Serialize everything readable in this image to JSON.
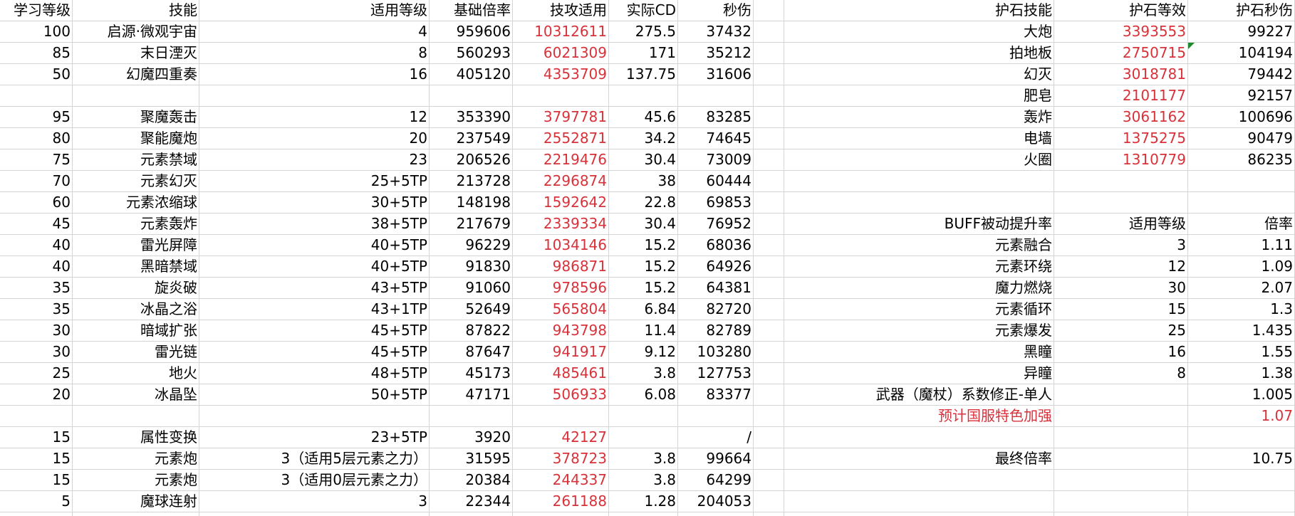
{
  "left": {
    "headers": [
      "学习等级",
      "技能",
      "适用等级",
      "基础倍率",
      "技攻适用",
      "实际CD",
      "秒伤"
    ],
    "rows": [
      [
        "100",
        "启源·微观宇宙",
        "4",
        "959606",
        "10312611",
        "275.5",
        "37432"
      ],
      [
        "85",
        "末日湮灭",
        "8",
        "560293",
        "6021309",
        "171",
        "35212"
      ],
      [
        "50",
        "幻魔四重奏",
        "16",
        "405120",
        "4353709",
        "137.75",
        "31606"
      ],
      [
        "",
        "",
        "",
        "",
        "",
        "",
        ""
      ],
      [
        "95",
        "聚魔轰击",
        "12",
        "353390",
        "3797781",
        "45.6",
        "83285"
      ],
      [
        "80",
        "聚能魔炮",
        "20",
        "237549",
        "2552871",
        "34.2",
        "74645"
      ],
      [
        "75",
        "元素禁域",
        "23",
        "206526",
        "2219476",
        "30.4",
        "73009"
      ],
      [
        "70",
        "元素幻灭",
        "25+5TP",
        "213728",
        "2296874",
        "38",
        "60444"
      ],
      [
        "60",
        "元素浓缩球",
        "30+5TP",
        "148198",
        "1592642",
        "22.8",
        "69853"
      ],
      [
        "45",
        "元素轰炸",
        "38+5TP",
        "217679",
        "2339334",
        "30.4",
        "76952"
      ],
      [
        "40",
        "雷光屏障",
        "40+5TP",
        "96229",
        "1034146",
        "15.2",
        "68036"
      ],
      [
        "40",
        "黑暗禁域",
        "40+5TP",
        "91830",
        "986871",
        "15.2",
        "64926"
      ],
      [
        "35",
        "旋炎破",
        "43+5TP",
        "91060",
        "978596",
        "15.2",
        "64381"
      ],
      [
        "35",
        "冰晶之浴",
        "43+1TP",
        "52649",
        "565804",
        "6.84",
        "82720"
      ],
      [
        "30",
        "暗域扩张",
        "45+5TP",
        "87822",
        "943798",
        "11.4",
        "82789"
      ],
      [
        "30",
        "雷光链",
        "45+5TP",
        "87647",
        "941917",
        "9.12",
        "103280"
      ],
      [
        "25",
        "地火",
        "48+5TP",
        "45173",
        "485461",
        "3.8",
        "127753"
      ],
      [
        "20",
        "冰晶坠",
        "50+5TP",
        "47171",
        "506933",
        "6.08",
        "83377"
      ],
      [
        "",
        "",
        "",
        "",
        "",
        "",
        ""
      ],
      [
        "15",
        "属性变换",
        "23+5TP",
        "3920",
        "42127",
        "",
        "/"
      ],
      [
        "15",
        "元素炮",
        "3（适用5层元素之力）",
        "31595",
        "378723",
        "3.8",
        "99664"
      ],
      [
        "15",
        "元素炮",
        "3（适用0层元素之力）",
        "20384",
        "244337",
        "3.8",
        "64299"
      ],
      [
        "5",
        "魔球连射",
        "3",
        "22344",
        "261188",
        "1.28",
        "204053"
      ],
      [
        "",
        "",
        "",
        "",
        "",
        "",
        ""
      ]
    ]
  },
  "right": {
    "rows": [
      [
        "护石技能",
        "护石等效",
        "护石秒伤"
      ],
      [
        "大炮",
        "3393553",
        "99227"
      ],
      [
        "拍地板",
        "2750715",
        "104194"
      ],
      [
        "幻灭",
        "3018781",
        "79442"
      ],
      [
        "肥皂",
        "2101177",
        "92157"
      ],
      [
        "轰炸",
        "3061162",
        "100696"
      ],
      [
        "电墙",
        "1375275",
        "90479"
      ],
      [
        "火圈",
        "1310779",
        "86235"
      ],
      [
        "",
        "",
        ""
      ],
      [
        "",
        "",
        ""
      ],
      [
        "BUFF被动提升率",
        "适用等级",
        "倍率"
      ],
      [
        "元素融合",
        "3",
        "1.11"
      ],
      [
        "元素环绕",
        "12",
        "1.09"
      ],
      [
        "魔力燃烧",
        "30",
        "2.07"
      ],
      [
        "元素循环",
        "15",
        "1.3"
      ],
      [
        "元素爆发",
        "25",
        "1.435"
      ],
      [
        "黑瞳",
        "16",
        "1.55"
      ],
      [
        "异瞳",
        "8",
        "1.38"
      ],
      [
        "武器（魔杖）系数修正-单人",
        "",
        "1.005"
      ],
      [
        "预计国服特色加强",
        "",
        "1.07"
      ],
      [
        "",
        "",
        ""
      ],
      [
        "最终倍率",
        "",
        "10.75"
      ],
      [
        "",
        "",
        ""
      ],
      [
        "",
        "",
        ""
      ]
    ]
  },
  "colors": {
    "grid": "#d4d4d4",
    "red": "#d9313a",
    "marker": "#1e8a2e"
  }
}
